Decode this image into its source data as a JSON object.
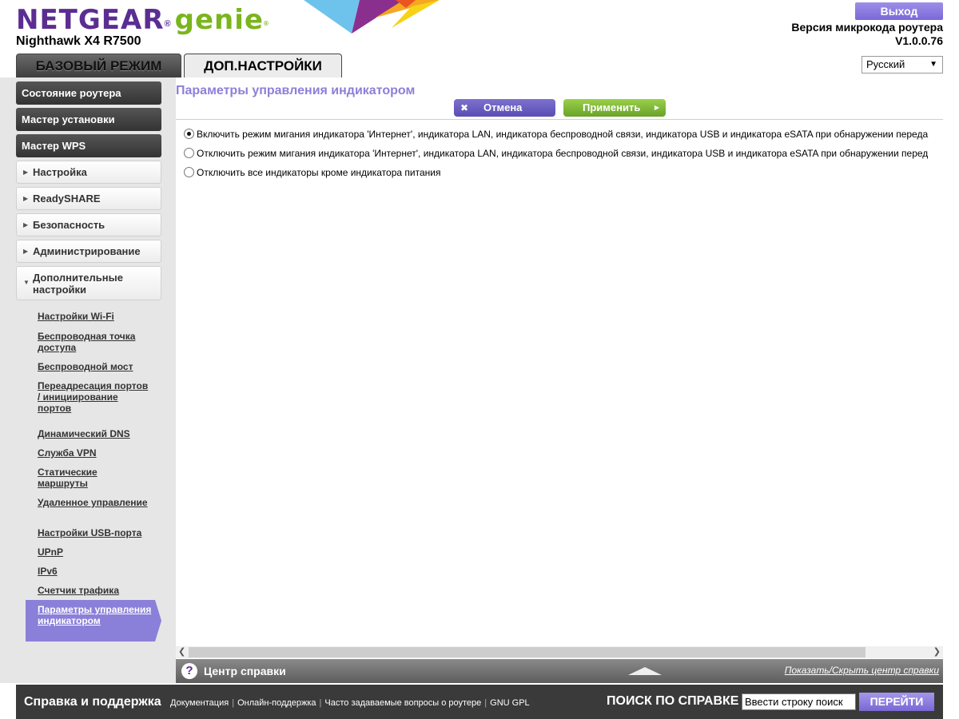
{
  "header": {
    "brand": "NETGEAR",
    "brand_mark": "®",
    "product": "genie",
    "product_mark": "®",
    "model": "Nighthawk X4 R7500",
    "logout_label": "Выход",
    "firmware_label": "Версия микрокода роутера",
    "firmware_version": "V1.0.0.76",
    "tabs": [
      {
        "label": "БАЗОВЫЙ РЕЖИМ",
        "active": false
      },
      {
        "label": "ДОП.НАСТРОЙКИ",
        "active": true
      }
    ],
    "language": "Русский",
    "decoration_colors": [
      "#6ec3ec",
      "#8b2f8f",
      "#f5a623",
      "#f7d217",
      "#e9541f"
    ]
  },
  "sidebar": {
    "main_items": [
      "Состояние роутера",
      "Мастер установки",
      "Мастер WPS"
    ],
    "menus": [
      "Настройка",
      "ReadySHARE",
      "Безопасность",
      "Администрирование",
      "Дополнительные настройки"
    ],
    "submenu": [
      "Настройки Wi-Fi",
      "Беспроводная точка доступа",
      "Беспроводной мост",
      "Переадресация портов / инициирование портов",
      "Динамический DNS",
      "Служба VPN",
      "Статические маршруты",
      "Удаленное управление",
      "Настройки USB-порта",
      "UPnP",
      "IPv6",
      "Счетчик трафика",
      "Параметры управления индикатором"
    ],
    "active_submenu": "Параметры управления индикатором"
  },
  "main": {
    "title": "Параметры управления индикатором",
    "cancel_label": "Отмена",
    "apply_label": "Применить",
    "options": [
      {
        "label": "Включить режим мигания индикатора 'Интернет', индикатора LAN, индикатора беспроводной связи, индикатора USB и индикатора eSATA при обнаружении переда",
        "selected": true
      },
      {
        "label": "Отключить режим мигания индикатора 'Интернет', индикатора LAN, индикатора беспроводной связи, индикатора USB и индикатора eSATA при обнаружении перед",
        "selected": false
      },
      {
        "label": "Отключить все индикаторы кроме индикатора питания",
        "selected": false
      }
    ]
  },
  "help": {
    "title": "Центр справки",
    "toggle": "Показать/Скрыть центр справки"
  },
  "footer": {
    "title": "Справка и поддержка",
    "links": [
      "Документация",
      "Онлайн-поддержка",
      "Часто задаваемые вопросы о роутере",
      "GNU GPL"
    ],
    "search_label": "ПОИСК ПО СПРАВКЕ",
    "search_value": "Ввести строку поиск",
    "search_button": "ПЕРЕЙТИ"
  },
  "colors": {
    "accent_purple": "#8d7fd9",
    "apply_green": "#7ab51d",
    "brand_purple": "#5b2d91"
  }
}
